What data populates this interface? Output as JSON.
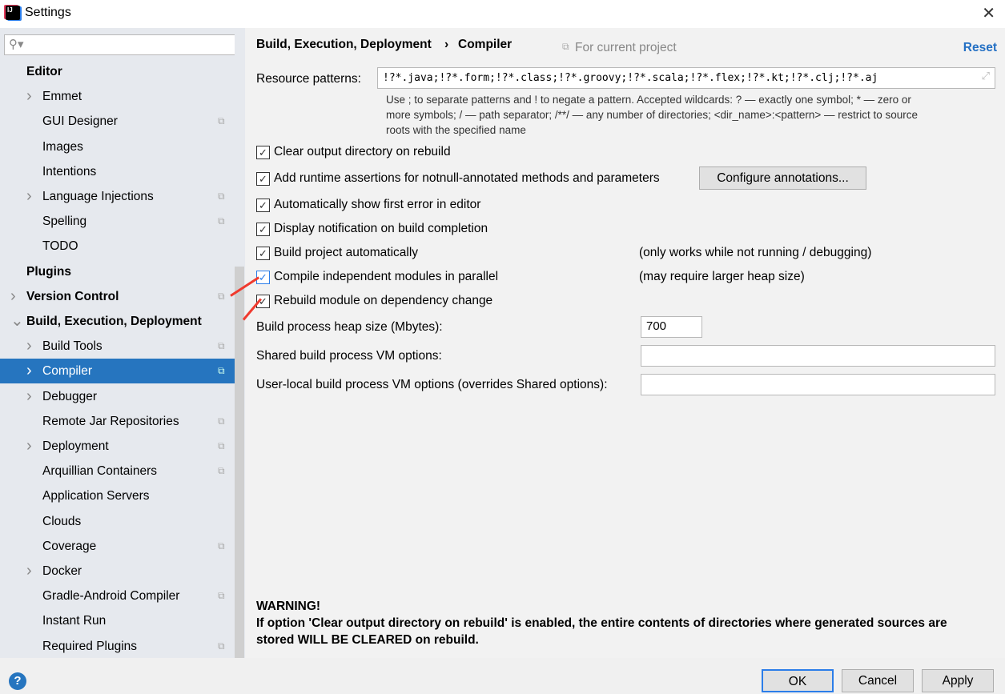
{
  "window": {
    "title": "Settings",
    "close": "✕"
  },
  "sidebar": {
    "search_placeholder": "",
    "items": [
      {
        "label": "Editor",
        "bold": true
      },
      {
        "label": "Emmet",
        "chevron": true
      },
      {
        "label": "GUI Designer",
        "copy": true
      },
      {
        "label": "Images"
      },
      {
        "label": "Intentions"
      },
      {
        "label": "Language Injections",
        "chevron": true,
        "copy": true
      },
      {
        "label": "Spelling",
        "copy": true
      },
      {
        "label": "TODO"
      },
      {
        "label": "Plugins",
        "bold": true
      },
      {
        "label": "Version Control",
        "bold": true,
        "chevron": true,
        "copy": true
      },
      {
        "label": "Build, Execution, Deployment",
        "bold": true,
        "expanded": true
      },
      {
        "label": "Build Tools",
        "chevron": true,
        "copy": true
      },
      {
        "label": "Compiler",
        "chevron": true,
        "copy": true,
        "selected": true
      },
      {
        "label": "Debugger",
        "chevron": true
      },
      {
        "label": "Remote Jar Repositories",
        "copy": true
      },
      {
        "label": "Deployment",
        "chevron": true,
        "copy": true
      },
      {
        "label": "Arquillian Containers",
        "copy": true
      },
      {
        "label": "Application Servers"
      },
      {
        "label": "Clouds"
      },
      {
        "label": "Coverage",
        "copy": true
      },
      {
        "label": "Docker",
        "chevron": true
      },
      {
        "label": "Gradle-Android Compiler",
        "copy": true
      },
      {
        "label": "Instant Run"
      },
      {
        "label": "Required Plugins",
        "copy": true
      }
    ]
  },
  "header": {
    "breadcrumb_parent": "Build, Execution, Deployment",
    "separator": "›",
    "breadcrumb_current": "Compiler",
    "scope": "For current project",
    "reset": "Reset"
  },
  "resource": {
    "label": "Resource patterns:",
    "value": "!?*.java;!?*.form;!?*.class;!?*.groovy;!?*.scala;!?*.flex;!?*.kt;!?*.clj;!?*.aj",
    "help_line1": "Use ; to separate patterns and ! to negate a pattern. Accepted wildcards: ? — exactly one symbol; * — zero or",
    "help_line2": "more symbols; / — path separator; /**/ — any number of directories; <dir_name>:<pattern> — restrict to source",
    "help_line3": "roots with the specified name"
  },
  "options": [
    {
      "label": "Clear output directory on rebuild",
      "checked": true
    },
    {
      "label": "Add runtime assertions for notnull-annotated methods and parameters",
      "checked": true
    },
    {
      "label": "Automatically show first error in editor",
      "checked": true
    },
    {
      "label": "Display notification on build completion",
      "checked": true
    },
    {
      "label": "Build project automatically",
      "checked": true,
      "note": "(only works while not running / debugging)"
    },
    {
      "label": "Compile independent modules in parallel",
      "checked": true,
      "note": "(may require larger heap size)"
    },
    {
      "label": "Rebuild module on dependency change",
      "checked": true
    }
  ],
  "configure_annotations": "Configure annotations...",
  "heap": {
    "label": "Build process heap size (Mbytes):",
    "value": "700"
  },
  "shared_vm": {
    "label": "Shared build process VM options:",
    "value": ""
  },
  "user_vm": {
    "label": "User-local build process VM options (overrides Shared options):",
    "value": ""
  },
  "warning": {
    "title": "WARNING!",
    "line1": "If option 'Clear output directory on rebuild' is enabled, the entire contents of directories where generated sources are",
    "line2": "stored WILL BE CLEARED on rebuild."
  },
  "footer": {
    "help": "?",
    "ok": "OK",
    "cancel": "Cancel",
    "apply": "Apply"
  },
  "colors": {
    "selection": "#2675bf",
    "link": "#2470c4",
    "annotation_arrow": "#f03a2e"
  }
}
